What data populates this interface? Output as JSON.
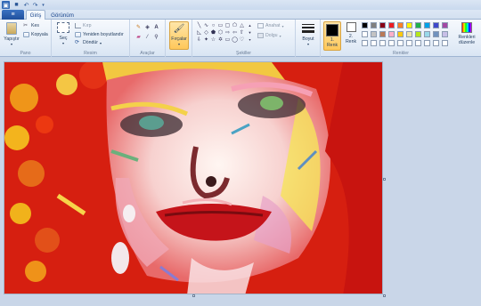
{
  "quick_access": {
    "icons": [
      "save-icon",
      "undo-icon",
      "redo-icon",
      "customize-quick-access-icon"
    ]
  },
  "tabs": {
    "file_label": "≡",
    "items": [
      {
        "label": "Giriş",
        "active": true
      },
      {
        "label": "Görünüm",
        "active": false
      }
    ]
  },
  "ribbon": {
    "clipboard": {
      "paste_label": "Yapıştır",
      "cut_label": "Kes",
      "copy_label": "Kopyala",
      "group_label": "Pano"
    },
    "image": {
      "select_label": "Seç",
      "crop_label": "Kırp",
      "resize_label": "Yeniden boyutlandır",
      "rotate_label": "Döndür",
      "group_label": "Resim"
    },
    "tools": {
      "group_label": "Araçlar"
    },
    "brushes": {
      "label": "Fırçalar"
    },
    "shapes": {
      "outline_label": "Anahat",
      "fill_label": "Dolgu",
      "group_label": "Şekiller"
    },
    "size": {
      "label": "Boyut"
    },
    "colors": {
      "color1_label": "1.\nRenk",
      "color2_label": "2.\nRenk",
      "edit_colors_label": "Renkleri düzenle",
      "group_label": "Renkler",
      "color1": "#000000",
      "color2": "#ffffff",
      "palette_row1": [
        "#000000",
        "#7f7f7f",
        "#880015",
        "#ed1c24",
        "#ff7f27",
        "#fff200",
        "#22b14c",
        "#00a2e8",
        "#3f48cc",
        "#a349a4"
      ],
      "palette_row2": [
        "#ffffff",
        "#c3c3c3",
        "#b97a57",
        "#ffaec9",
        "#ffc90e",
        "#efe4b0",
        "#b5e61d",
        "#99d9ea",
        "#7092be",
        "#c8bfe7"
      ],
      "palette_row3": [
        "#ffffff",
        "#ffffff",
        "#ffffff",
        "#ffffff",
        "#ffffff",
        "#ffffff",
        "#ffffff",
        "#ffffff",
        "#ffffff",
        "#ffffff"
      ]
    }
  }
}
